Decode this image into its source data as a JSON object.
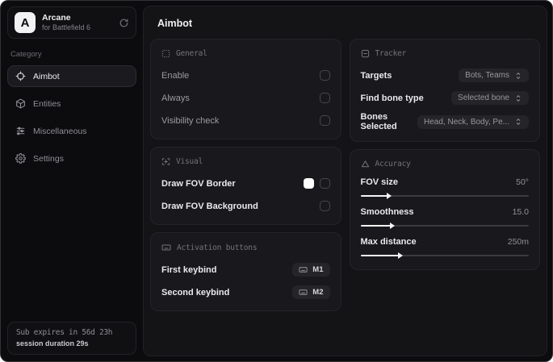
{
  "brand": {
    "logo_letter": "A",
    "name": "Arcane",
    "subtitle": "for Battlefield 6",
    "action_icon": "refresh-icon"
  },
  "sidebar": {
    "category_label": "Category",
    "items": [
      {
        "label": "Aimbot",
        "icon": "crosshair-icon",
        "active": true
      },
      {
        "label": "Entities",
        "icon": "cube-icon",
        "active": false
      },
      {
        "label": "Miscellaneous",
        "icon": "sliders-icon",
        "active": false
      },
      {
        "label": "Settings",
        "icon": "gear-icon",
        "active": false
      }
    ],
    "footer": {
      "expiry": "Sub expires in 56d 23h",
      "session": "session duration 29s"
    }
  },
  "main": {
    "title": "Aimbot",
    "general": {
      "header": "General",
      "icon": "grid-icon",
      "rows": [
        {
          "label": "Enable",
          "checked": false
        },
        {
          "label": "Always",
          "checked": false
        },
        {
          "label": "Visibility check",
          "checked": false
        }
      ]
    },
    "visual": {
      "header": "Visual",
      "icon": "frame-plus-icon",
      "rows": [
        {
          "label": "Draw FOV Border",
          "swatch": "#ffffff",
          "checked": false
        },
        {
          "label": "Draw FOV Background",
          "checked": false
        }
      ]
    },
    "activation": {
      "header": "Activation buttons",
      "icon": "keyboard-icon",
      "rows": [
        {
          "label": "First keybind",
          "key": "M1"
        },
        {
          "label": "Second keybind",
          "key": "M2"
        }
      ]
    },
    "tracker": {
      "header": "Tracker",
      "icon": "scan-icon",
      "rows": [
        {
          "label": "Targets",
          "value": "Bots, Teams"
        },
        {
          "label": "Find bone type",
          "value": "Selected bone"
        },
        {
          "label": "Bones Selected",
          "value": "Head, Neck, Body, Pe..."
        }
      ]
    },
    "accuracy": {
      "header": "Accuracy",
      "icon": "triangle-icon",
      "rows": [
        {
          "label": "FOV size",
          "value": "50°",
          "percent": 16
        },
        {
          "label": "Smoothness",
          "value": "15.0",
          "percent": 18
        },
        {
          "label": "Max distance",
          "value": "250m",
          "percent": 23
        }
      ]
    }
  }
}
